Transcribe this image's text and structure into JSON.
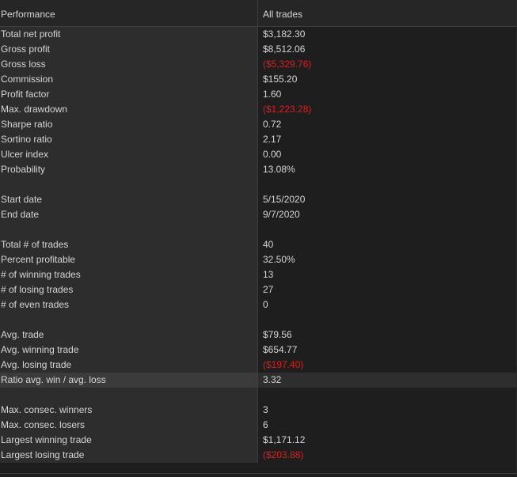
{
  "header": {
    "col1": "Performance",
    "col2": "All trades"
  },
  "rows": [
    {
      "label": "Total net profit",
      "value": "$3,182.30",
      "negative": false
    },
    {
      "label": "Gross profit",
      "value": "$8,512.06",
      "negative": false
    },
    {
      "label": "Gross loss",
      "value": "($5,329.76)",
      "negative": true
    },
    {
      "label": "Commission",
      "value": "$155.20",
      "negative": false
    },
    {
      "label": "Profit factor",
      "value": "1.60",
      "negative": false
    },
    {
      "label": "Max. drawdown",
      "value": "($1,223.28)",
      "negative": true
    },
    {
      "label": "Sharpe ratio",
      "value": "0.72",
      "negative": false
    },
    {
      "label": "Sortino ratio",
      "value": "2.17",
      "negative": false
    },
    {
      "label": "Ulcer index",
      "value": "0.00",
      "negative": false
    },
    {
      "label": "Probability",
      "value": "13.08%",
      "negative": false
    },
    {
      "label": "",
      "value": "",
      "negative": false
    },
    {
      "label": "Start date",
      "value": "5/15/2020",
      "negative": false
    },
    {
      "label": "End date",
      "value": "9/7/2020",
      "negative": false
    },
    {
      "label": "",
      "value": "",
      "negative": false
    },
    {
      "label": "Total # of trades",
      "value": "40",
      "negative": false
    },
    {
      "label": "Percent profitable",
      "value": "32.50%",
      "negative": false
    },
    {
      "label": "# of winning trades",
      "value": "13",
      "negative": false
    },
    {
      "label": "# of losing trades",
      "value": "27",
      "negative": false
    },
    {
      "label": "# of even trades",
      "value": "0",
      "negative": false
    },
    {
      "label": "",
      "value": "",
      "negative": false
    },
    {
      "label": "Avg. trade",
      "value": "$79.56",
      "negative": false
    },
    {
      "label": "Avg. winning trade",
      "value": "$654.77",
      "negative": false
    },
    {
      "label": "Avg. losing trade",
      "value": "($197.40)",
      "negative": true
    },
    {
      "label": "Ratio avg. win / avg. loss",
      "value": "3.32",
      "negative": false,
      "selected": true
    },
    {
      "label": "",
      "value": "",
      "negative": false
    },
    {
      "label": "Max. consec. winners",
      "value": "3",
      "negative": false
    },
    {
      "label": "Max. consec. losers",
      "value": "6",
      "negative": false
    },
    {
      "label": "Largest winning trade",
      "value": "$1,171.12",
      "negative": false
    },
    {
      "label": "Largest losing trade",
      "value": "($203.88)",
      "negative": true
    }
  ]
}
